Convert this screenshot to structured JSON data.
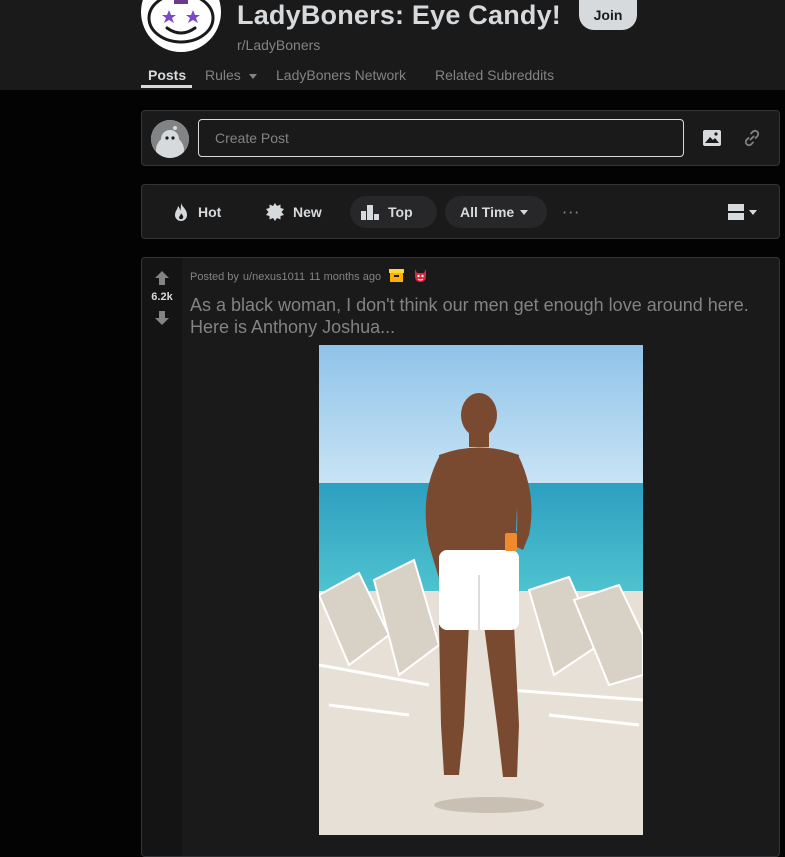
{
  "subreddit": {
    "title": "LadyBoners: Eye Candy!",
    "name": "r/LadyBoners",
    "join_label": "Join",
    "icon": "reddit-snoo-star-eyes-icon"
  },
  "nav": {
    "posts": "Posts",
    "rules": "Rules",
    "network": "LadyBoners Network",
    "related": "Related Subreddits"
  },
  "create_post": {
    "placeholder": "Create Post"
  },
  "sort": {
    "hot": "Hot",
    "new": "New",
    "top": "Top",
    "time_range": "All Time",
    "more": "···"
  },
  "post": {
    "score": "6.2k",
    "posted_by": "Posted by",
    "author": "u/nexus1011",
    "time": "11 months ago",
    "title": "As a black woman, I don't think our men get enough love around here. Here is Anthony Joshua...",
    "awards": [
      "archive-box-award-icon",
      "red-devil-award-icon"
    ]
  },
  "colors": {
    "background": "#030303",
    "surface": "#1a1a1b",
    "border": "#343536",
    "text": "#d7dadc",
    "muted": "#818384"
  }
}
